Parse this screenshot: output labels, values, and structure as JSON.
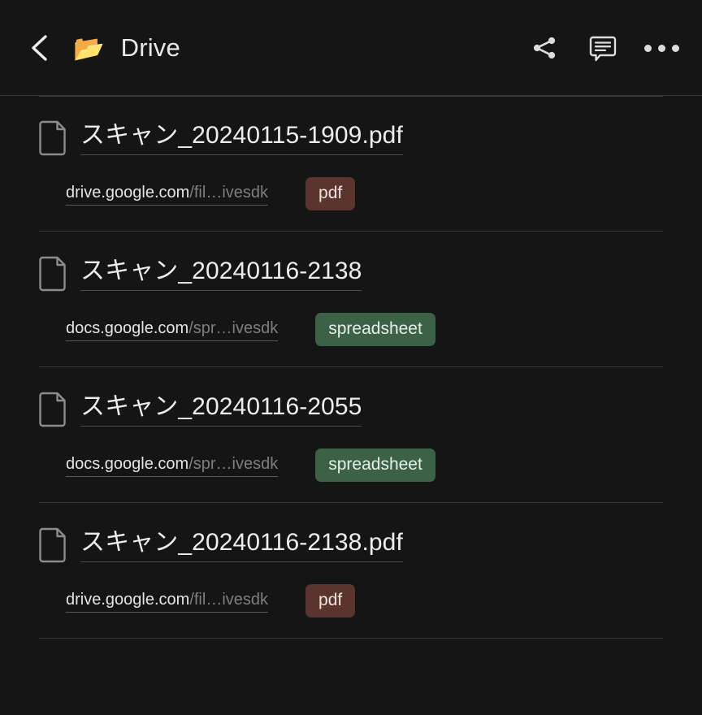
{
  "header": {
    "back_icon": "chevron-left-icon",
    "folder_icon": "open-folder-emoji",
    "folder_glyph": "📂",
    "title": "Drive",
    "share_icon": "share-icon",
    "comment_icon": "comment-bubble-icon",
    "overflow_icon": "more-horizontal-icon"
  },
  "colors": {
    "background": "#151515",
    "text_primary": "#ededed",
    "text_muted": "#7e7e7e",
    "divider": "#343434",
    "badge_pdf_bg": "#5c342f",
    "badge_pdf_text": "#f0e2de",
    "badge_spreadsheet_bg": "#3d6147",
    "badge_spreadsheet_text": "#e4f0e6",
    "folder_yellow": "#f2c14b"
  },
  "list": {
    "items": [
      {
        "icon": "file-document-icon",
        "title": "スキャン_20240115-1909.pdf",
        "url_host": "drive.google.com",
        "url_path": "/fil…ivesdk",
        "badge": "pdf",
        "badge_type": "pdf"
      },
      {
        "icon": "file-document-icon",
        "title": "スキャン_20240116-2138",
        "url_host": "docs.google.com",
        "url_path": "/spr…ivesdk",
        "badge": "spreadsheet",
        "badge_type": "spreadsheet"
      },
      {
        "icon": "file-document-icon",
        "title": "スキャン_20240116-2055",
        "url_host": "docs.google.com",
        "url_path": "/spr…ivesdk",
        "badge": "spreadsheet",
        "badge_type": "spreadsheet"
      },
      {
        "icon": "file-document-icon",
        "title": "スキャン_20240116-2138.pdf",
        "url_host": "drive.google.com",
        "url_path": "/fil…ivesdk",
        "badge": "pdf",
        "badge_type": "pdf"
      }
    ]
  }
}
